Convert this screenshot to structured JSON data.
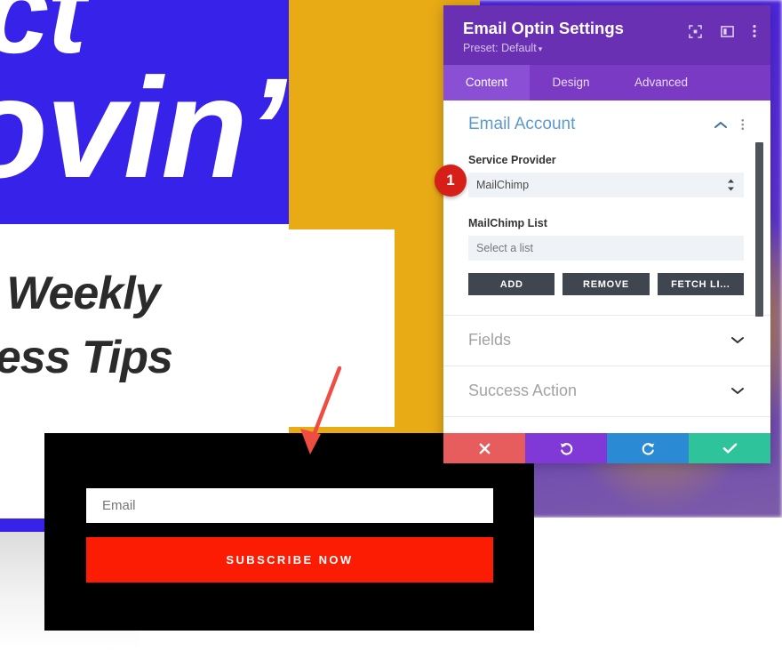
{
  "page_background": {
    "hero_word_1": "ct",
    "hero_word_2": "ovin’",
    "card_line_1": "e Weekly",
    "card_line_2": "ness Tips",
    "colors": {
      "hero_blue": "#3622e8",
      "hero_yellow": "#e8ab16",
      "card_text": "#2b2b2b"
    }
  },
  "optin_form": {
    "email_placeholder": "Email",
    "subscribe_label": "SUBSCRIBE NOW",
    "background": "#000000",
    "button_color": "#fc1c04"
  },
  "annotation": {
    "arrow_color": "#ef4c42",
    "step_number": "1",
    "step_badge_color": "#d61f18"
  },
  "panel": {
    "title": "Email Optin Settings",
    "preset": "Preset: Default",
    "preset_caret": "▾",
    "header_color": "#6a30b3",
    "header_icons": [
      {
        "name": "fullscreen-icon"
      },
      {
        "name": "layout-toggle-icon"
      },
      {
        "name": "more-options-icon"
      }
    ],
    "tabs": [
      {
        "label": "Content",
        "active": true
      },
      {
        "label": "Design",
        "active": false
      },
      {
        "label": "Advanced",
        "active": false
      }
    ],
    "sections": {
      "email_account": {
        "title": "Email Account",
        "collapse_icon": "chevron-up-icon",
        "options_icon": "more-options-icon",
        "service_provider": {
          "label": "Service Provider",
          "value": "MailChimp"
        },
        "mailchimp_list": {
          "label": "MailChimp List",
          "placeholder": "Select a list"
        },
        "buttons": [
          {
            "label": "ADD"
          },
          {
            "label": "REMOVE"
          },
          {
            "label": "FETCH LI..."
          }
        ]
      },
      "collapsed": [
        {
          "label": "Fields",
          "icon": "chevron-down-icon"
        },
        {
          "label": "Success Action",
          "icon": "chevron-down-icon"
        }
      ]
    },
    "action_bar": [
      {
        "name": "close-button",
        "icon": "x-icon",
        "color": "#e75d5d"
      },
      {
        "name": "undo-button",
        "icon": "undo-icon",
        "color": "#8039d6"
      },
      {
        "name": "redo-button",
        "icon": "redo-icon",
        "color": "#2a8ad4"
      },
      {
        "name": "save-button",
        "icon": "check-icon",
        "color": "#2ec39b"
      }
    ]
  }
}
